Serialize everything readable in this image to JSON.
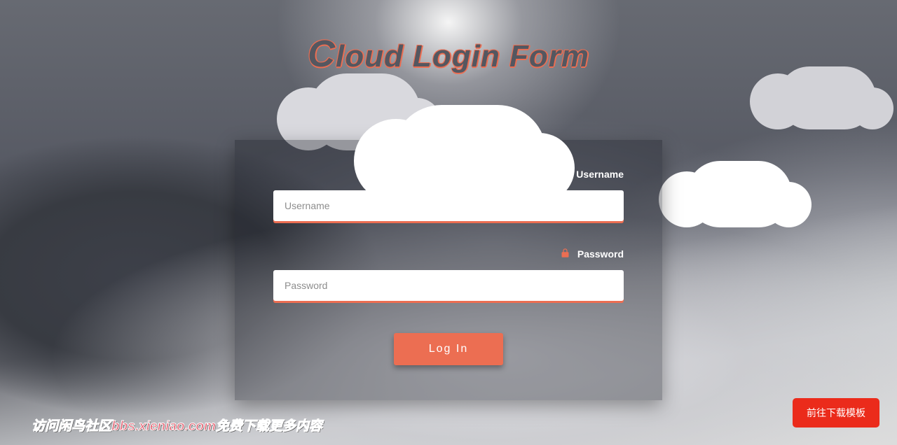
{
  "title": "Cloud Login Form",
  "form": {
    "username": {
      "label": "Username",
      "placeholder": "Username",
      "value": ""
    },
    "password": {
      "label": "Password",
      "placeholder": "Password",
      "value": ""
    },
    "submit_label": "Log In"
  },
  "promo_text": "访问闲鸟社区bbs.xieniao.com免费下载更多内容",
  "download_button": "前往下载模板",
  "colors": {
    "accent": "#ec6e52",
    "danger": "#eb2b1b"
  }
}
